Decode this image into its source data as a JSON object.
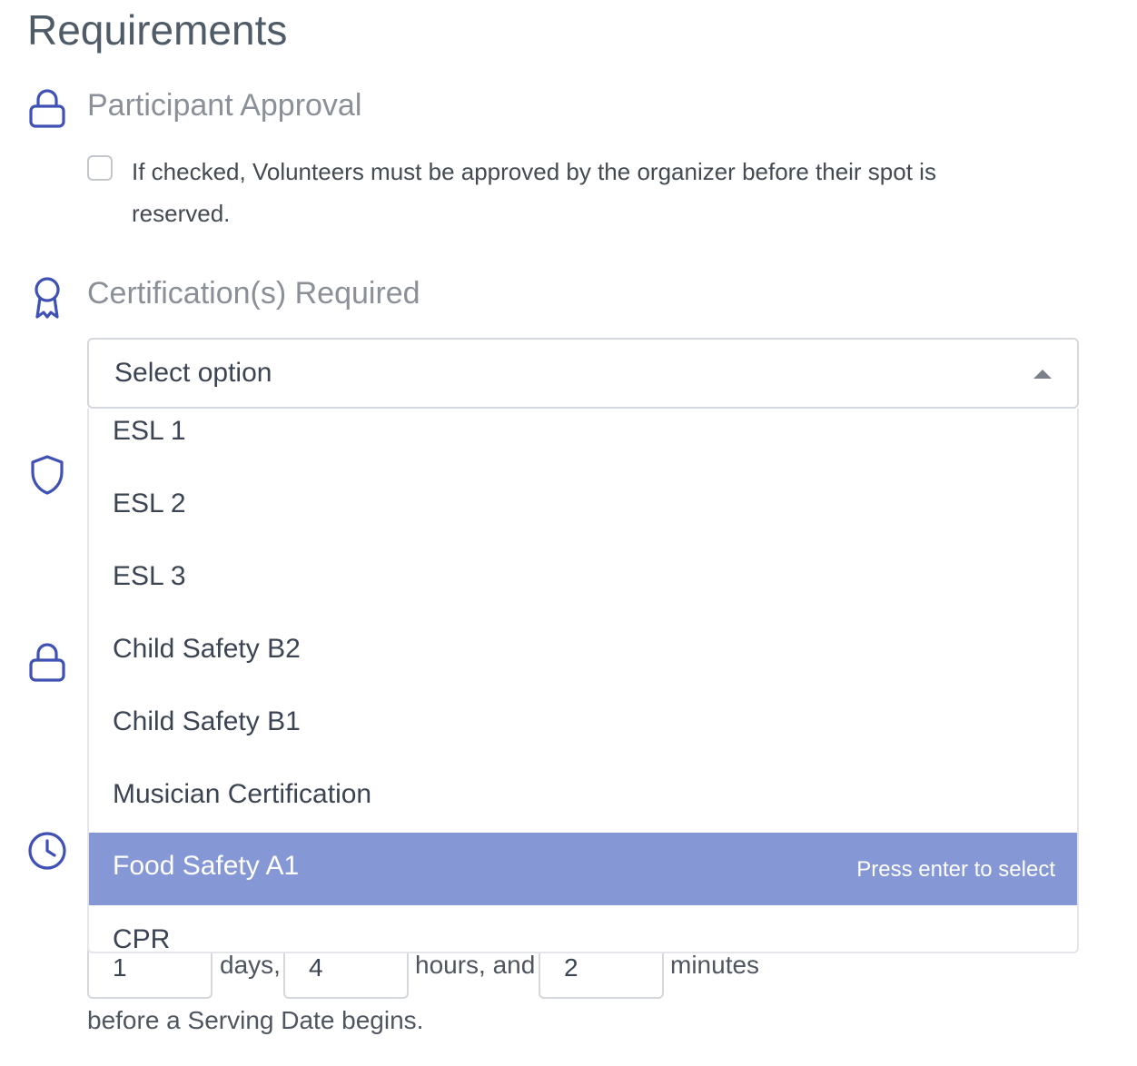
{
  "title": "Requirements",
  "participant_approval": {
    "heading": "Participant Approval",
    "checkbox_text": "If checked, Volunteers must be approved by the organizer before their spot is reserved.",
    "checked": false
  },
  "certifications": {
    "heading": "Certification(s) Required",
    "select_placeholder": "Select option",
    "options": [
      "ESL 1",
      "ESL 2",
      "ESL 3",
      "Child Safety B2",
      "Child Safety B1",
      "Musician Certification",
      "Food Safety A1",
      "CPR"
    ],
    "highlighted_option": "Food Safety A1",
    "highlight_hint": "Press enter to select"
  },
  "deadline": {
    "days_value": "1",
    "days_label": "days,",
    "hours_value": "4",
    "hours_label": "hours, and",
    "minutes_value": "2",
    "minutes_label": "minutes",
    "suffix": "before a Serving Date begins."
  },
  "icons": {
    "participant_approval": "lock-icon",
    "certifications": "award-ribbon-icon",
    "hidden_section_1": "shield-icon",
    "hidden_section_2": "lock-icon",
    "hidden_section_3": "clock-icon"
  },
  "colors": {
    "icon": "#3f51b5",
    "highlight": "#8597d5"
  }
}
